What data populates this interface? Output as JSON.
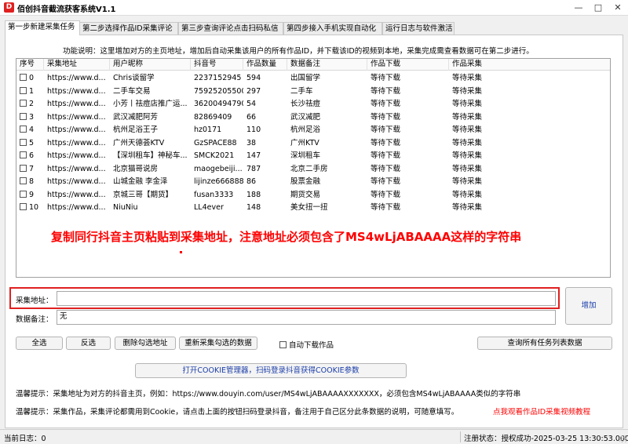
{
  "window": {
    "title": "佰创抖音截流获客系统V1.1",
    "icon_letter": "D",
    "minimize": "—",
    "maximize": "□",
    "close": "✕"
  },
  "tabs": [
    "第一步新建采集任务",
    "第二步选择作品ID采集评论",
    "第三步查询评论点击扫码私信",
    "第四步接入手机实现自动化",
    "运行日志与软件激活"
  ],
  "func_desc": "功能说明：这里增加对方的主页地址，增加后自动采集该用户的所有作品ID，并下载该ID的视频到本地，采集完成需查看数据可在第二步进行。",
  "table": {
    "columns": [
      "序号",
      "采集地址",
      "用户昵称",
      "抖音号",
      "作品数量",
      "数据备注",
      "作品下载",
      "作品采集"
    ],
    "rows": [
      [
        "0",
        "https://www.d...",
        "Chris谈留学",
        "2237152945",
        "594",
        "出国留学",
        "等待下载",
        "等待采集"
      ],
      [
        "1",
        "https://www.d...",
        "二手车交易",
        "75925205500",
        "297",
        "二手车",
        "等待下载",
        "等待采集"
      ],
      [
        "2",
        "https://www.d...",
        "小芳丨祛痘店推广运...",
        "36200494790",
        "54",
        "长沙祛痘",
        "等待下载",
        "等待采集"
      ],
      [
        "3",
        "https://www.d...",
        "武汉减肥阿芳",
        "82869409",
        "66",
        "武汉减肥",
        "等待下载",
        "等待采集"
      ],
      [
        "4",
        "https://www.d...",
        "杭州足浴王子",
        "hz0171",
        "110",
        "杭州足浴",
        "等待下载",
        "等待采集"
      ],
      [
        "5",
        "https://www.d...",
        "广州天德荟KTV",
        "GzSPACE88",
        "38",
        "广州KTV",
        "等待下载",
        "等待采集"
      ],
      [
        "6",
        "https://www.d...",
        "【深圳租车】神秘车...",
        "SMCK2021",
        "147",
        "深圳租车",
        "等待下载",
        "等待采集"
      ],
      [
        "7",
        "https://www.d...",
        "北京猫哥说房",
        "maogebeiji...",
        "787",
        "北京二手房",
        "等待下载",
        "等待采集"
      ],
      [
        "8",
        "https://www.d...",
        "山城金融 李金泽",
        "lijinze666888",
        "86",
        "股票金融",
        "等待下载",
        "等待采集"
      ],
      [
        "9",
        "https://www.d...",
        "京城三哥【期货】",
        "fusan3333",
        "188",
        "期货交易",
        "等待下载",
        "等待采集"
      ],
      [
        "10",
        "https://www.d...",
        "NiuNiu",
        "LL4ever",
        "148",
        "美女扭一扭",
        "等待下载",
        "等待采集"
      ]
    ]
  },
  "overlay_tip": "复制同行抖音主页粘贴到采集地址，注意地址必须包含了MS4wLjABAAAA这样的字符串",
  "form": {
    "address_label": "采集地址：",
    "address_value": "",
    "remark_label": "数据备注：",
    "remark_value": "无",
    "add_button": "增加"
  },
  "actions": {
    "select_all": "全选",
    "invert": "反选",
    "delete_checked": "删除勾选地址",
    "recollect": "重新采集勾选的数据",
    "auto_download": "自动下载作品",
    "query_all": "查询所有任务列表数据",
    "cookie_manager": "打开COOKIE管理器，扫码登录抖音获得COOKIE参数"
  },
  "tips": {
    "tip1": "温馨提示：采集地址为对方的抖音主页，例如：https://www.douyin.com/user/MS4wLjABAAAAXXXXXXX，必须包含MS4wLjABAAAA类似的字符串",
    "tip2": "温馨提示：采集作品，采集评论都需用到Cookie，请点击上面的按钮扫码登录抖音，备注用于自己区分此条数据的说明，可随意填写。",
    "tip_link": "点我观看作品ID采集视频教程"
  },
  "status": {
    "log": "当前日志：0",
    "reg": "注册状态：授权成功-2025-03-25 13:30:53.000"
  }
}
